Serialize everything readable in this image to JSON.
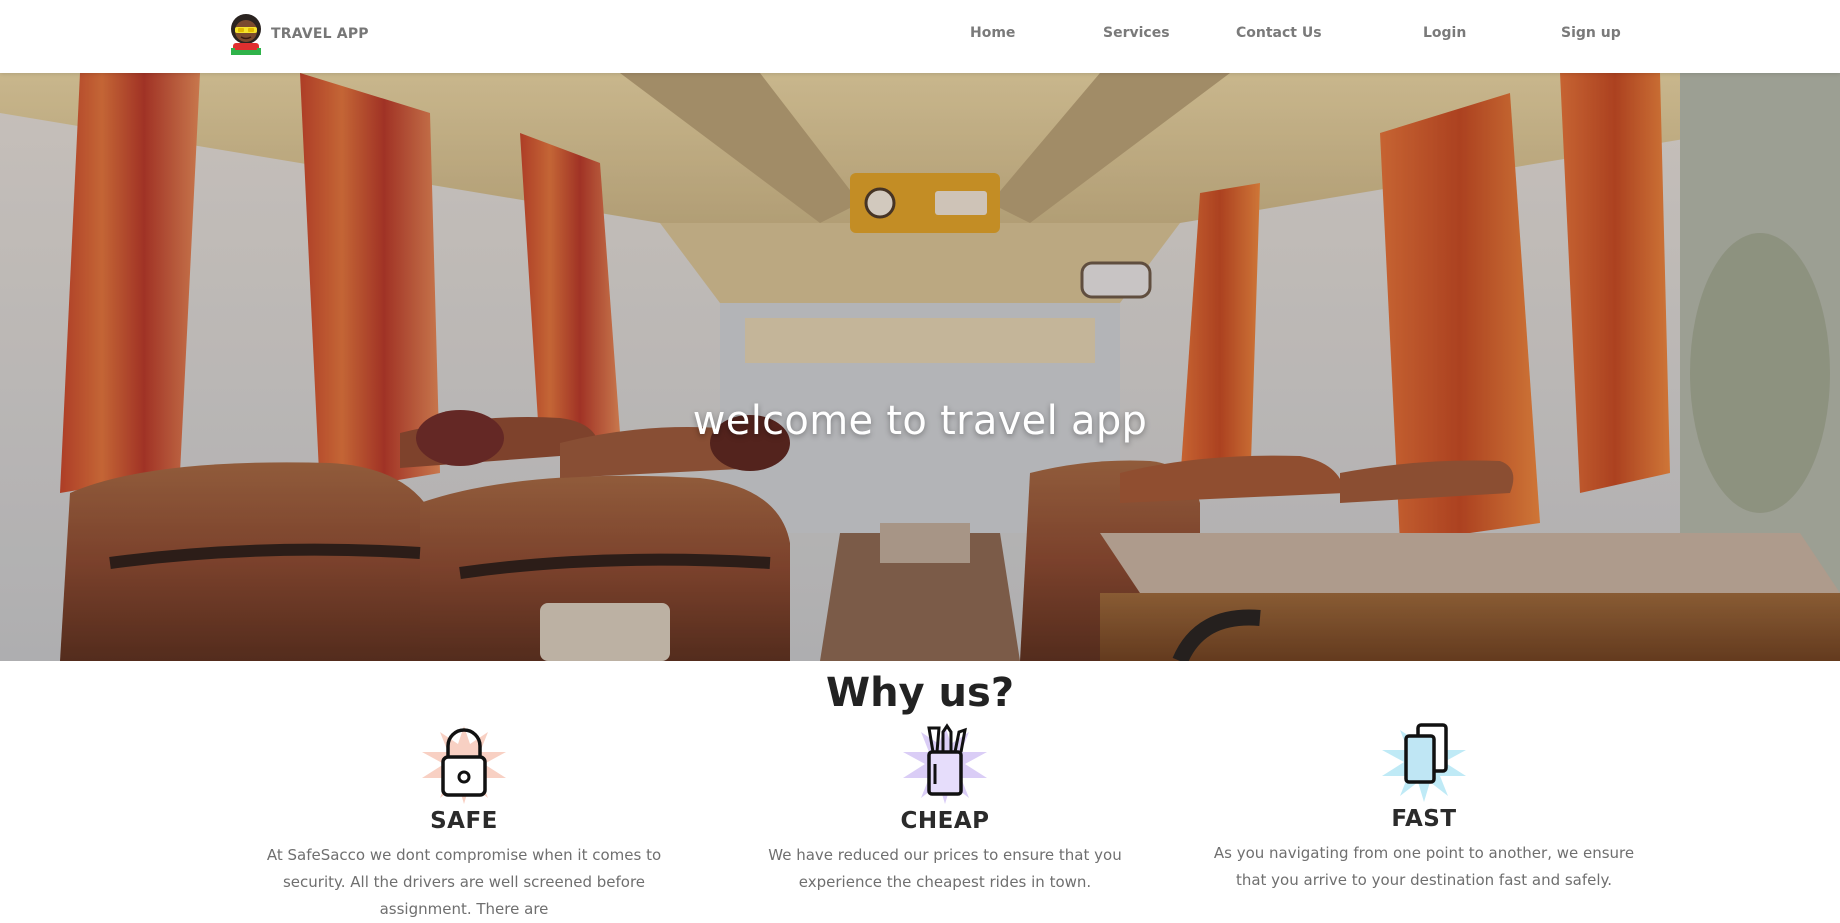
{
  "navbar": {
    "brand": "TRAVEL APP",
    "links": [
      "Home",
      "Services",
      "Contact Us",
      "Login",
      "Sign up"
    ]
  },
  "hero": {
    "title": "welcome to travel app"
  },
  "why_us": {
    "title": "Why us?",
    "features": [
      {
        "title": "SAFE",
        "icon": "padlock-icon",
        "accent": "#f7c8b8",
        "text": "At SafeSacco we dont compromise when it comes to security. All the drivers are well screened before assignment. There are"
      },
      {
        "title": "CHEAP",
        "icon": "pencil-cup-icon",
        "accent": "#d6c8f5",
        "text": "We have reduced our prices to ensure that you experience the cheapest rides in town."
      },
      {
        "title": "FAST",
        "icon": "documents-icon",
        "accent": "#b8e8f5",
        "text": "As you navigating from one point to another, we ensure that you arrive to your destination fast and safely."
      }
    ]
  }
}
